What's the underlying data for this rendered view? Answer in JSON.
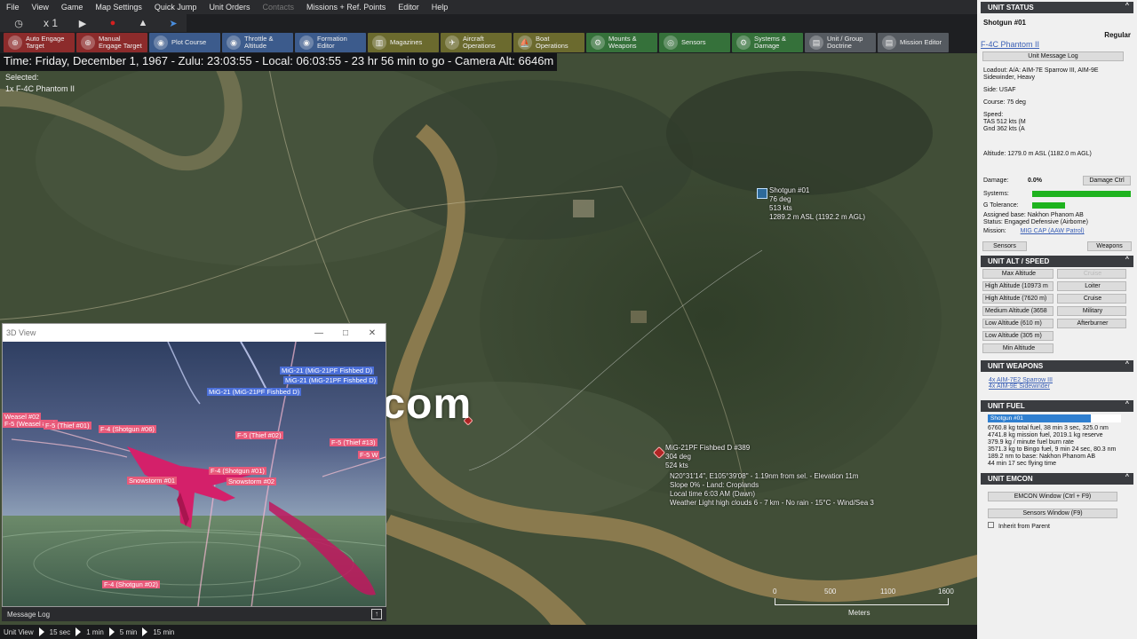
{
  "menubar": [
    "File",
    "View",
    "Game",
    "Map Settings",
    "Quick Jump",
    "Unit Orders",
    "Contacts",
    "Missions + Ref. Points",
    "Editor",
    "Help"
  ],
  "timebar": {
    "speed": "x 1"
  },
  "toolbar": [
    {
      "label": "Auto Engage Target",
      "color": "red"
    },
    {
      "label": "Manual Engage Target",
      "color": "red"
    },
    {
      "label": "Plot Course",
      "color": "blue"
    },
    {
      "label": "Throttle & Altitude",
      "color": "blue"
    },
    {
      "label": "Formation Editor",
      "color": "blue"
    },
    {
      "label": "Magazines",
      "color": "olive"
    },
    {
      "label": "Aircraft Operations",
      "color": "olive"
    },
    {
      "label": "Boat Operations",
      "color": "olive"
    },
    {
      "label": "Mounts & Weapons",
      "color": "green"
    },
    {
      "label": "Sensors",
      "color": "green"
    },
    {
      "label": "Systems & Damage",
      "color": "green"
    },
    {
      "label": "Unit / Group Doctrine",
      "color": "grey"
    },
    {
      "label": "Mission Editor",
      "color": "grey"
    }
  ],
  "timeline": "Time: Friday, December 1, 1967 - Zulu: 23:03:55 - Local: 06:03:55 - 23 hr 56 min to go -  Camera Alt: 6646m",
  "selected": {
    "label": "Selected:",
    "value": "1x F-4C Phantom II"
  },
  "map": {
    "friendly_unit": {
      "name": "Shotgun #01",
      "course": "76 deg",
      "speed": "513 kts",
      "alt": "1289.2 m ASL (1192.2 m AGL)"
    },
    "hostile_unit": {
      "name": "MiG-21PF Fishbed D #389",
      "course": "304 deg",
      "speed": "524 kts"
    },
    "hover": {
      "coords": "N20°31'14\", E105°39'08\" - 1.19nm from sel. - Elevation 11m",
      "slope": "Slope 0%  -  Land: Croplands",
      "local_time": "Local time 6:03 AM (Dawn)",
      "weather": "Weather Light high clouds 6 - 7 km - No rain - 15°C - Wind/Sea 3"
    },
    "scale": {
      "ticks": [
        "0",
        "500",
        "1100",
        "1600"
      ],
      "unit": "Meters"
    }
  },
  "watermark": "gamck.com",
  "view3d": {
    "title": "3D View",
    "labels": [
      {
        "text": "MiG-21 (MiG-21PF Fishbed D)",
        "color": "blue"
      },
      {
        "text": "MiG-21 (MiG-21PF Fishbed D)",
        "color": "blue"
      },
      {
        "text": "MiG-21 (MiG-21PF Fishbed D)",
        "color": "blue"
      },
      {
        "text": "Weasel #02",
        "color": "red"
      },
      {
        "text": "F-5 (Weasel #01)",
        "color": "red"
      },
      {
        "text": "F-5 (Thief #01)",
        "color": "red"
      },
      {
        "text": "F-4 (Shotgun #06)",
        "color": "red"
      },
      {
        "text": "F-5 (Thief #02)",
        "color": "red"
      },
      {
        "text": "F-4 (Shotgun #01)",
        "color": "red"
      },
      {
        "text": "Snowstorm #01",
        "color": "red"
      },
      {
        "text": "Snowstorm #02",
        "color": "red"
      },
      {
        "text": "F-5 (Thief #13)",
        "color": "red"
      },
      {
        "text": "F-5 W",
        "color": "red"
      },
      {
        "text": "F-4 (Shotgun #02)",
        "color": "red"
      }
    ]
  },
  "message_log": "Message Log",
  "statusbar": {
    "label": "Unit View",
    "steps": [
      "15 sec",
      "1 min",
      "5 min",
      "15 min"
    ]
  },
  "panel": {
    "status": {
      "header": "UNIT STATUS",
      "unit_name": "Shotgun #01",
      "proficiency": "Regular",
      "class_link": "F-4C Phantom II",
      "msg_log_btn": "Unit Message Log",
      "loadout": "Loadout: A/A: AIM-7E Sparrow III, AIM-9E Sidewinder, Heavy",
      "side": "Side: USAF",
      "course": "Course: 75 deg",
      "speed_label": "Speed:",
      "tas": "TAS 512 kts (M",
      "gnd": "Gnd 362 kts (A",
      "altitude": "Altitude: 1279.0 m ASL (1182.0 m AGL)",
      "damage_label": "Damage:",
      "damage_value": "0.0%",
      "damage_btn": "Damage Ctrl",
      "systems_label": "Systems:",
      "systems_fill": 1.0,
      "gtol_label": "G Tolerance:",
      "gtol_fill": 0.33,
      "assigned_base": "Assigned base: Nakhon Phanom AB",
      "status_line": "Status: Engaged Defensive (Airborne)",
      "mission_label": "Mission:",
      "mission_link": "MIG CAP (AAW Patrol)",
      "sensors_btn": "Sensors",
      "weapons_btn": "Weapons",
      "bar_color": "#1fb31f"
    },
    "altspeed": {
      "header": "UNIT ALT / SPEED",
      "left": [
        "Max Altitude",
        "High Altitude (10973 m",
        "High Altitude (7620 m)",
        "Medium Altitude (3658",
        "Low Altitude (610 m)",
        "Low Altitude (305 m)",
        "Min Altitude"
      ],
      "right": [
        "Cruise",
        "Loiter",
        "Cruise",
        "Military",
        "Afterburner"
      ]
    },
    "weapons": {
      "header": "UNIT WEAPONS",
      "items": [
        "4x AIM-7E2 Sparrow III",
        "4x AIM-9E Sidewinder"
      ]
    },
    "fuel": {
      "header": "UNIT FUEL",
      "bar_label": "Shotgun #01",
      "fill": 0.77,
      "lines": [
        "6760.8 kg total fuel, 38 min 3 sec, 325.0 nm",
        "4741.8 kg mission fuel, 2019.1 kg reserve",
        "379.9 kg / minute fuel burn rate",
        "3571.3 kg to Bingo fuel, 9 min 24 sec, 80.3 nm",
        "189.2 nm to base: Nakhon Phanom AB",
        "44 min 17 sec flying time"
      ],
      "bar_color": "#2f7fd0"
    },
    "emcon": {
      "header": "UNIT EMCON",
      "emcon_btn": "EMCON Window (Ctrl + F9)",
      "sensors_btn": "Sensors Window (F9)",
      "inherit": "Inherit from Parent"
    }
  }
}
